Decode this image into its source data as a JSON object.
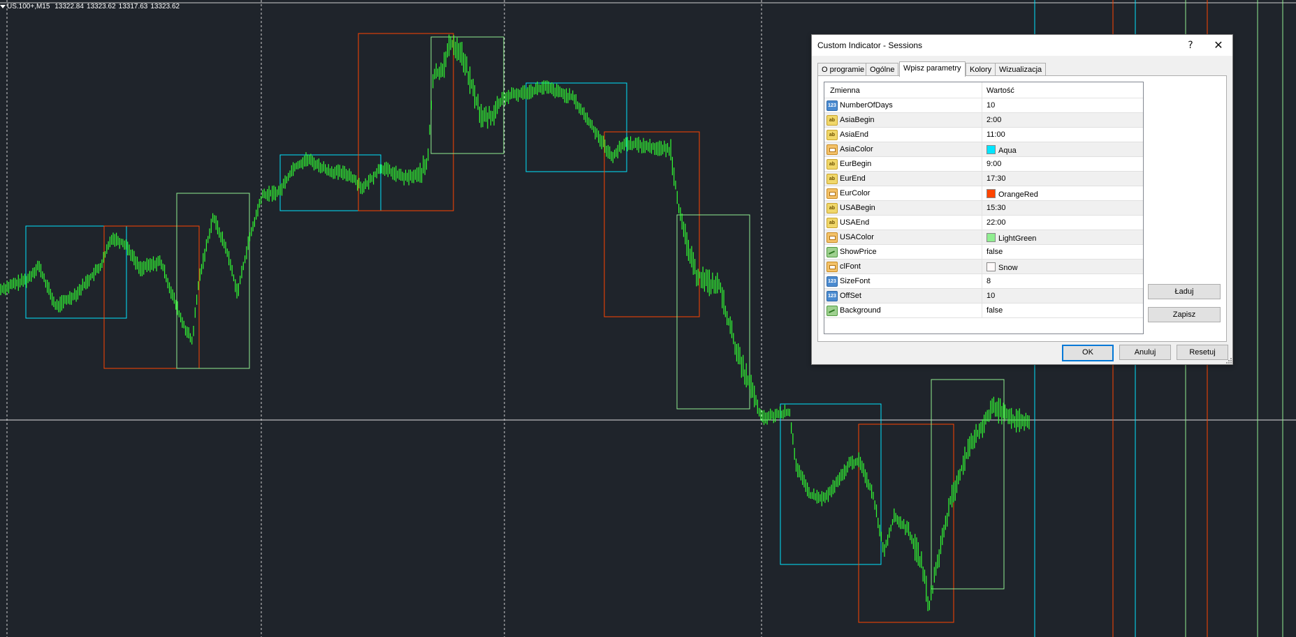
{
  "chart": {
    "symbol": "US.100+,M15",
    "ohlc": [
      "13322.84",
      "13323.62",
      "13317.63",
      "13323.62"
    ],
    "colors": {
      "background": "#1f242b",
      "candle": "#33ff33",
      "asia": "#00e5ff",
      "eur": "#ff4500",
      "usa": "#90ee90",
      "grid": "#e0e0e0"
    }
  },
  "dialog": {
    "title": "Custom Indicator - Sessions",
    "help_icon": "?",
    "close_icon": "✕",
    "tabs": [
      "O programie",
      "Ogólne",
      "Wpisz parametry",
      "Kolory",
      "Wizualizacja"
    ],
    "active_tab": 2,
    "grid": {
      "headers": [
        "Zmienna",
        "Wartość"
      ],
      "rows": [
        {
          "name": "NumberOfDays",
          "type": "int",
          "value": "10"
        },
        {
          "name": "AsiaBegin",
          "type": "string",
          "value": "2:00"
        },
        {
          "name": "AsiaEnd",
          "type": "string",
          "value": "11:00"
        },
        {
          "name": "AsiaColor",
          "type": "color",
          "value": "Aqua",
          "swatch": "#00e5ff"
        },
        {
          "name": "EurBegin",
          "type": "string",
          "value": "9:00"
        },
        {
          "name": "EurEnd",
          "type": "string",
          "value": "17:30"
        },
        {
          "name": "EurColor",
          "type": "color",
          "value": "OrangeRed",
          "swatch": "#ff4500"
        },
        {
          "name": "USABegin",
          "type": "string",
          "value": "15:30"
        },
        {
          "name": "USAEnd",
          "type": "string",
          "value": "22:00"
        },
        {
          "name": "USAColor",
          "type": "color",
          "value": "LightGreen",
          "swatch": "#90ee90"
        },
        {
          "name": "ShowPrice",
          "type": "bool",
          "value": "false"
        },
        {
          "name": "clFont",
          "type": "color",
          "value": "Snow",
          "swatch": "#fffafa"
        },
        {
          "name": "SizeFont",
          "type": "int",
          "value": "8"
        },
        {
          "name": "OffSet",
          "type": "int",
          "value": "10"
        },
        {
          "name": "Background",
          "type": "bool",
          "value": "false"
        }
      ]
    },
    "buttons": {
      "load": "Ładuj",
      "save": "Zapisz",
      "ok": "OK",
      "cancel": "Anuluj",
      "reset": "Resetuj"
    }
  }
}
